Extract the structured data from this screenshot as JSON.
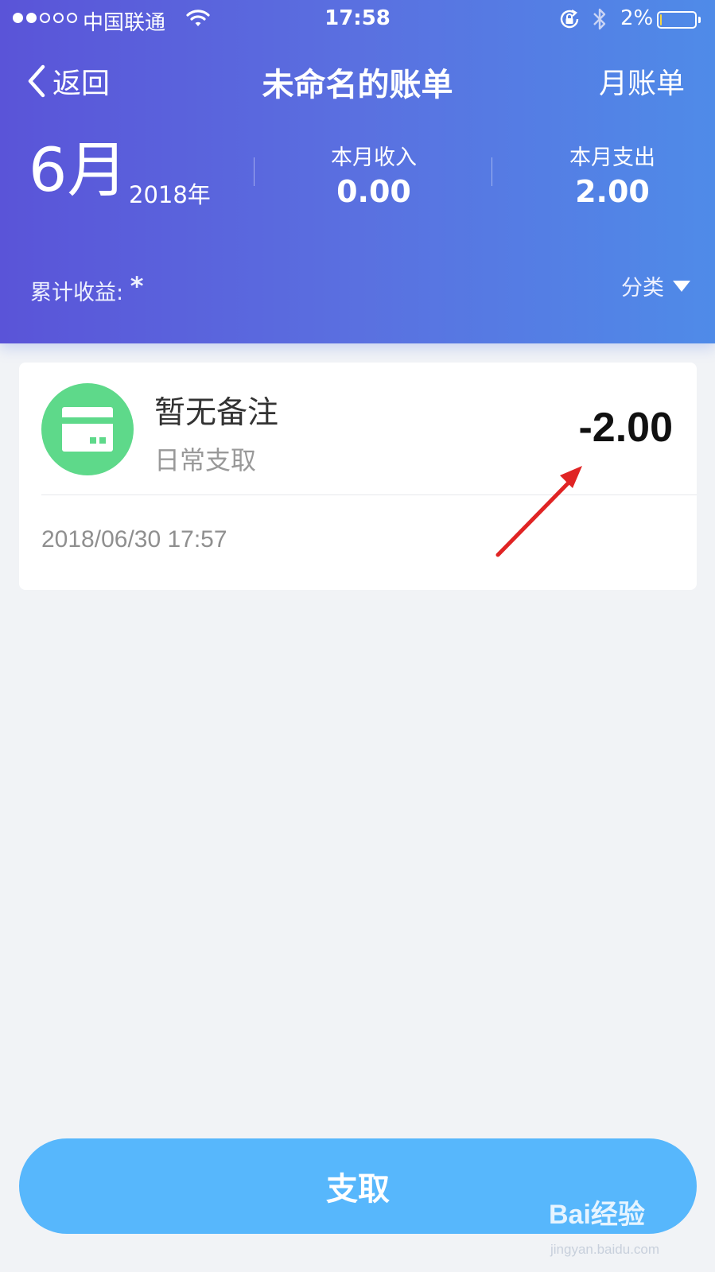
{
  "status_bar": {
    "carrier": "中国联通",
    "time": "17:58",
    "battery_percent": "2%",
    "battery_level": 0.02,
    "battery_fill_color": "#f5d542",
    "signal_bars_filled": 2,
    "signal_bars_total": 5
  },
  "nav": {
    "back_label": "返回",
    "title": "未命名的账单",
    "monthly_label": "月账单"
  },
  "summary": {
    "month": "6月",
    "year": "2018年",
    "income_label": "本月收入",
    "income_value": "0.00",
    "expense_label": "本月支出",
    "expense_value": "2.00",
    "cumulative_label": "累计收益:",
    "cumulative_value": "*",
    "category_label": "分类"
  },
  "transactions": [
    {
      "icon": "credit-card-icon",
      "note": "暂无备注",
      "category": "日常支取",
      "amount": "-2.00",
      "datetime": "2018/06/30 17:57"
    }
  ],
  "footer": {
    "withdraw_label": "支取"
  },
  "watermark": {
    "text": "Bai经验",
    "url": "jingyan.baidu.com"
  },
  "colors": {
    "header_gradient_start": "#5a54d8",
    "header_gradient_end": "#4f8be8",
    "primary_button": "#57b7fc",
    "icon_green": "#5ed98a",
    "annotation_red": "#e02424"
  }
}
